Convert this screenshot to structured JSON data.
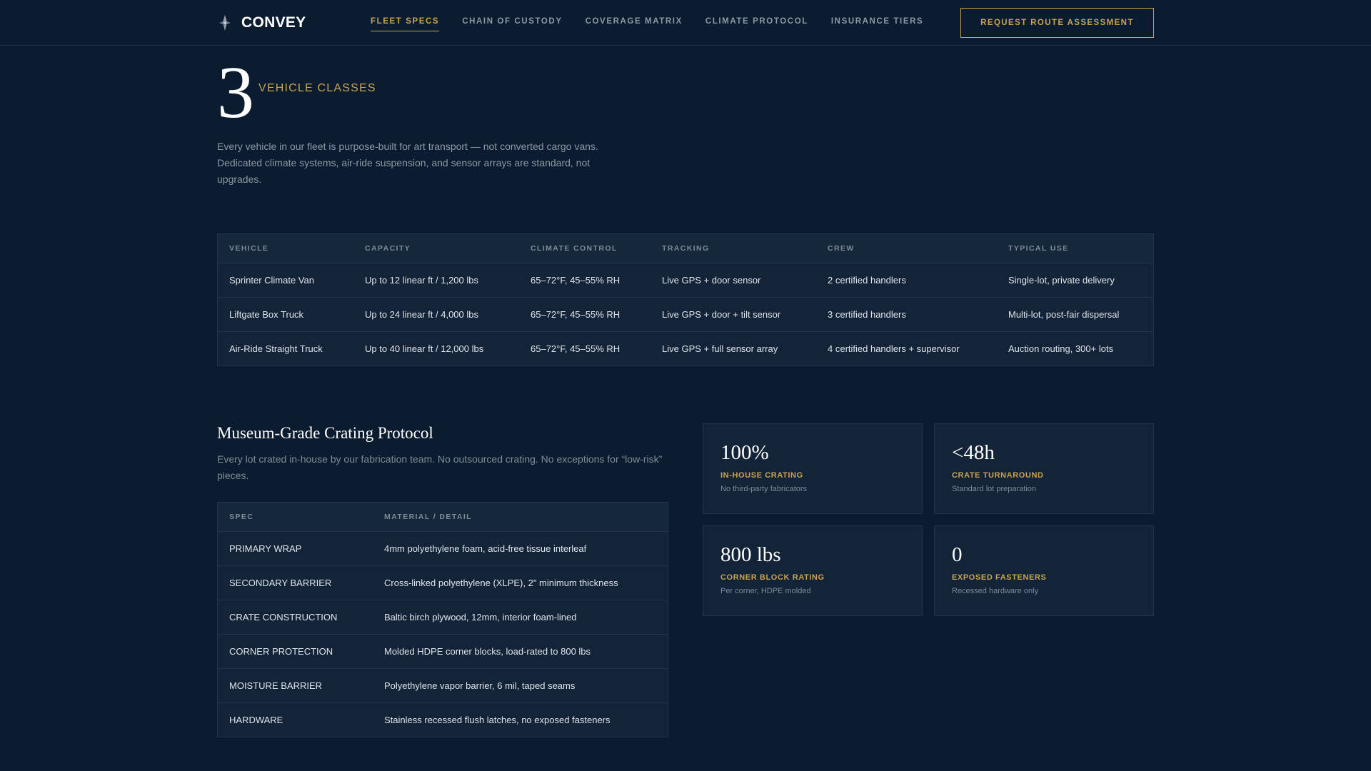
{
  "header": {
    "brand": "CONVEY",
    "nav": [
      {
        "label": "FLEET SPECS",
        "active": true
      },
      {
        "label": "CHAIN OF CUSTODY",
        "active": false
      },
      {
        "label": "COVERAGE MATRIX",
        "active": false
      },
      {
        "label": "CLIMATE PROTOCOL",
        "active": false
      },
      {
        "label": "INSURANCE TIERS",
        "active": false
      }
    ],
    "cta": "REQUEST ROUTE ASSESSMENT"
  },
  "hero": {
    "number": "3",
    "label": "VEHICLE CLASSES",
    "description": "Every vehicle in our fleet is purpose-built for art transport — not converted cargo vans. Dedicated climate systems, air-ride suspension, and sensor arrays are standard, not upgrades."
  },
  "vehicles": {
    "columns": [
      "VEHICLE",
      "CAPACITY",
      "CLIMATE CONTROL",
      "TRACKING",
      "CREW",
      "TYPICAL USE"
    ],
    "rows": [
      [
        "Sprinter Climate Van",
        "Up to 12 linear ft / 1,200 lbs",
        "65–72°F, 45–55% RH",
        "Live GPS + door sensor",
        "2 certified handlers",
        "Single-lot, private delivery"
      ],
      [
        "Liftgate Box Truck",
        "Up to 24 linear ft / 4,000 lbs",
        "65–72°F, 45–55% RH",
        "Live GPS + door + tilt sensor",
        "3 certified handlers",
        "Multi-lot, post-fair dispersal"
      ],
      [
        "Air-Ride Straight Truck",
        "Up to 40 linear ft / 12,000 lbs",
        "65–72°F, 45–55% RH",
        "Live GPS + full sensor array",
        "4 certified handlers + supervisor",
        "Auction routing, 300+ lots"
      ]
    ]
  },
  "crating": {
    "title": "Museum-Grade Crating Protocol",
    "description": "Every lot crated in-house by our fabrication team. No outsourced crating. No exceptions for “low-risk” pieces.",
    "columns": [
      "SPEC",
      "MATERIAL / DETAIL"
    ],
    "rows": [
      [
        "PRIMARY WRAP",
        "4mm polyethylene foam, acid-free tissue interleaf"
      ],
      [
        "SECONDARY BARRIER",
        "Cross-linked polyethylene (XLPE), 2\" minimum thickness"
      ],
      [
        "CRATE CONSTRUCTION",
        "Baltic birch plywood, 12mm, interior foam-lined"
      ],
      [
        "CORNER PROTECTION",
        "Molded HDPE corner blocks, load-rated to 800 lbs"
      ],
      [
        "MOISTURE BARRIER",
        "Polyethylene vapor barrier, 6 mil, taped seams"
      ],
      [
        "HARDWARE",
        "Stainless recessed flush latches, no exposed fasteners"
      ]
    ]
  },
  "stats": [
    {
      "value": "100%",
      "label": "IN-HOUSE CRATING",
      "sub": "No third-party fabricators"
    },
    {
      "value": "<48h",
      "label": "CRATE TURNAROUND",
      "sub": "Standard lot preparation"
    },
    {
      "value": "800 lbs",
      "label": "CORNER BLOCK RATING",
      "sub": "Per corner, HDPE molded"
    },
    {
      "value": "0",
      "label": "EXPOSED FASTENERS",
      "sub": "Recessed hardware only"
    }
  ],
  "colors": {
    "background": "#0c1c30",
    "panel": "#132438",
    "accent": "#c9a34e",
    "muted": "#8d98a6"
  }
}
